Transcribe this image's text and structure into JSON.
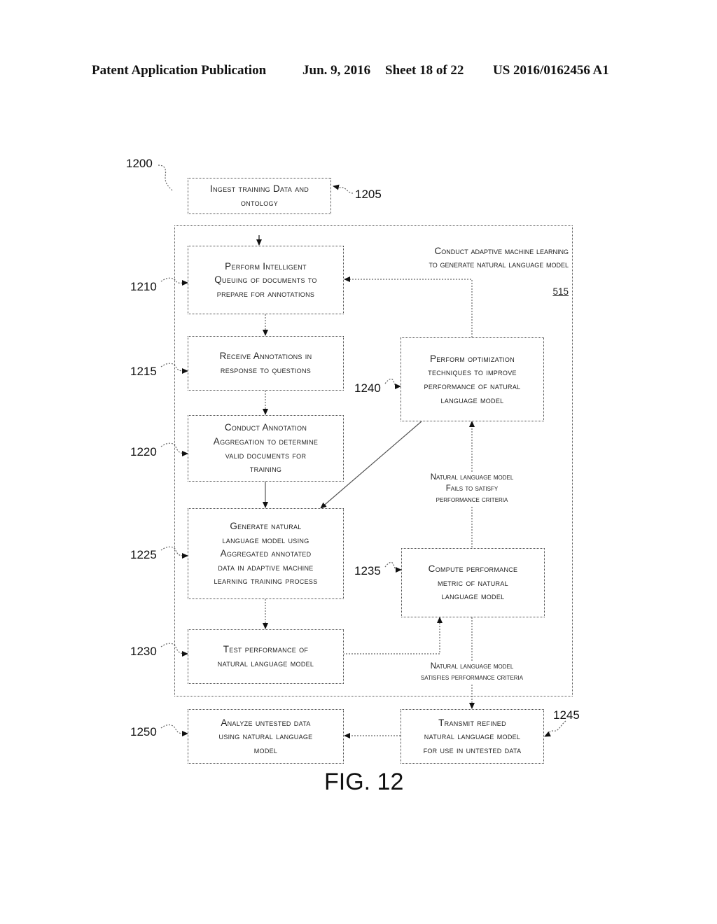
{
  "header": {
    "publication": "Patent Application Publication",
    "date": "Jun. 9, 2016",
    "sheet": "Sheet 18 of 22",
    "number": "US 2016/0162456 A1"
  },
  "figure": {
    "ref": "1200",
    "caption": "FIG. 12",
    "container": {
      "title": "Conduct adaptive machine learning\nto generate natural language model",
      "number": "515"
    },
    "steps": [
      {
        "id": "1205",
        "text": "Ingest training Data and\nontology"
      },
      {
        "id": "1210",
        "text": "Perform Intelligent\nQueuing of documents to\nprepare for annotations"
      },
      {
        "id": "1215",
        "text": "Receive Annotations in\nresponse to questions"
      },
      {
        "id": "1220",
        "text": "Conduct Annotation\nAggregation to determine\nvalid documents for\ntraining"
      },
      {
        "id": "1225",
        "text": "Generate natural\nlanguage model using\nAggregated annotated\ndata in adaptive machine\nlearning training process"
      },
      {
        "id": "1230",
        "text": "Test performance of\nnatural language model"
      },
      {
        "id": "1235",
        "text": "Compute performance\nmetric of natural\nlanguage model"
      },
      {
        "id": "1240",
        "text": "Perform optimization\ntechniques to improve\nperformance of natural\nlanguage model"
      },
      {
        "id": "1245",
        "text": "Transmit refined\nnatural language model\nfor use in untested data"
      },
      {
        "id": "1250",
        "text": "Analyze untested data\nusing natural language\nmodel"
      }
    ],
    "conditions": {
      "fails": "Natural language model\nFails to satisfy\nperformance criteria",
      "satisfies": "Natural language model\nsatisfies performance criteria"
    }
  }
}
